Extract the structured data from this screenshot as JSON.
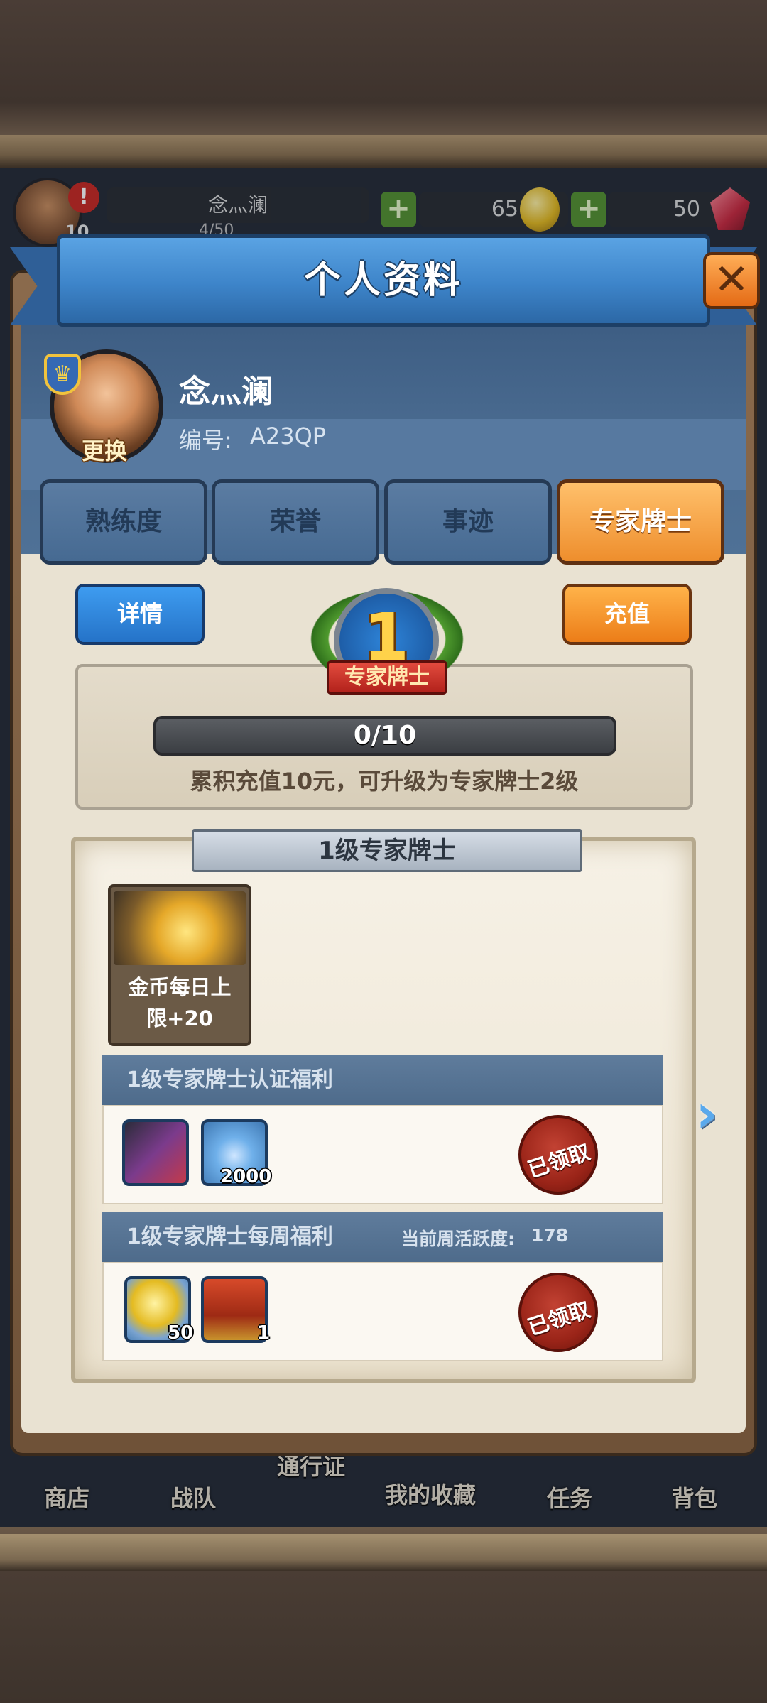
{
  "hud": {
    "player_name": "念灬澜",
    "level": "10",
    "progress_text": "4/50",
    "coins": "65",
    "gems": "50",
    "plus": "+",
    "alert": "!"
  },
  "bottom_nav": {
    "items": [
      "商店",
      "战队",
      "通行证",
      "我的收藏",
      "任务",
      "背包"
    ]
  },
  "modal": {
    "title": "个人资料",
    "close": "✕"
  },
  "profile": {
    "name": "念灬澜",
    "id_label": "编号:",
    "id_value": "A23QP",
    "change_label": "更换",
    "crown": "♛"
  },
  "tabs": [
    {
      "label": "熟练度",
      "active": false
    },
    {
      "label": "荣誉",
      "active": false
    },
    {
      "label": "事迹",
      "active": false
    },
    {
      "label": "专家牌士",
      "active": true
    }
  ],
  "vip": {
    "detail_label": "详情",
    "recharge_label": "充值",
    "level": "1",
    "medal_label": "专家牌士",
    "progress_text": "0/10",
    "progress_current": 0,
    "progress_max": 10,
    "hint": "累积充值10元，可升级为专家牌士2级"
  },
  "panel": {
    "header": "1级专家牌士",
    "perk": {
      "line1": "金币每日上",
      "line2": "限+20"
    },
    "cert_section": {
      "title": "1级专家牌士认证福利",
      "items": [
        {
          "icon": "hero-avatar-icon",
          "count": ""
        },
        {
          "icon": "potion-icon",
          "count": "2000"
        }
      ],
      "status": "已领取"
    },
    "weekly_section": {
      "title": "1级专家牌士每周福利",
      "activity_label": "当前周活跃度:",
      "activity_value": "178",
      "items": [
        {
          "icon": "gold-coin-icon",
          "count": "50"
        },
        {
          "icon": "treasure-chest-icon",
          "count": "1"
        }
      ],
      "status": "已领取"
    },
    "next_arrow": "›"
  },
  "colors": {
    "ribbon_blue": "#3d84c9",
    "tab_active": "#ee8e2d",
    "tab_inactive": "#466a92",
    "section_head": "#5f7c9c",
    "seal_red": "#9a2418"
  }
}
